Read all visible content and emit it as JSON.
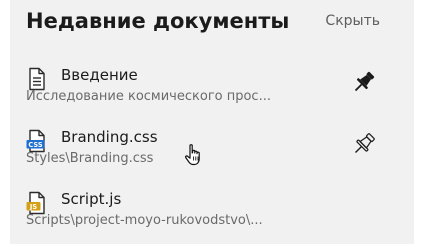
{
  "panel": {
    "title": "Недавние документы",
    "hide_label": "Скрыть"
  },
  "items": [
    {
      "name": "Введение",
      "path": "Исследование космического прос...",
      "icon": "document-icon",
      "pinned": true
    },
    {
      "name": "Branding.css",
      "path": "Styles\\Branding.css",
      "icon": "css-file-icon",
      "icon_text": "CSS",
      "pinned": false
    },
    {
      "name": "Script.js",
      "path": "Scripts\\project-moyo-rukovodstvo\\...",
      "icon": "js-file-icon",
      "icon_text": "JS",
      "pinned": false
    }
  ],
  "colors": {
    "panel_background": "#f1f1f1",
    "css_badge": "#1f6fd1",
    "js_badge": "#d4a017"
  }
}
